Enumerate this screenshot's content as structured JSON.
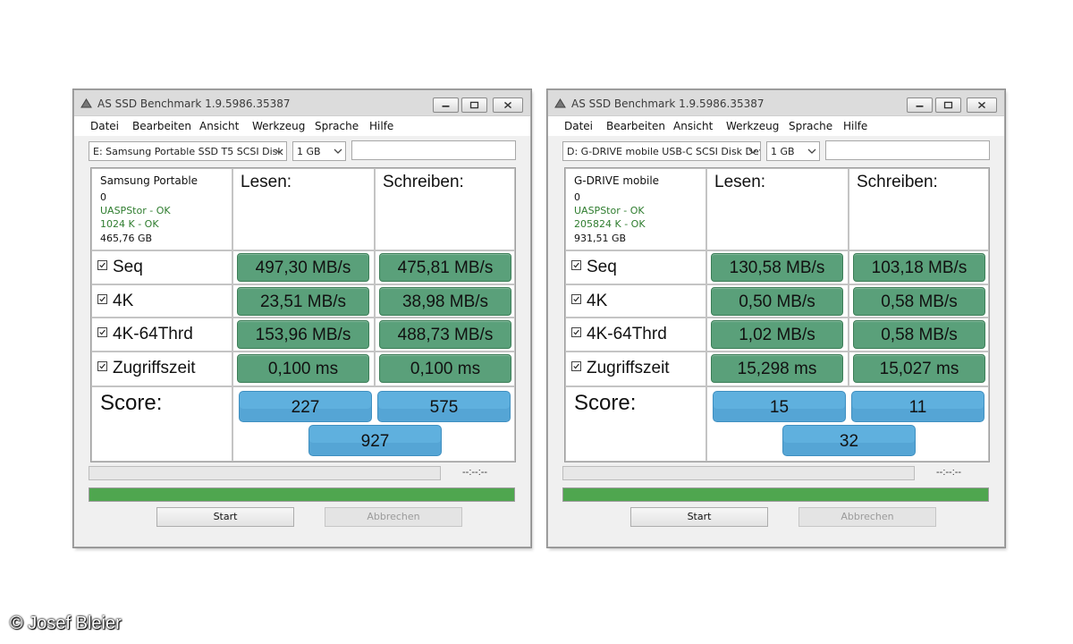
{
  "credit": "© Josef Bleier",
  "windows": [
    {
      "title": "AS SSD Benchmark 1.9.5986.35387",
      "menu": [
        "Datei",
        "Bearbeiten",
        "Ansicht",
        "Werkzeug",
        "Sprache",
        "Hilfe"
      ],
      "drive": "E: Samsung Portable SSD T5 SCSI Disk D",
      "size": "1 GB",
      "info": {
        "name": "Samsung Portable",
        "line1": "0",
        "line2": "UASPStor - OK",
        "line3": "1024 K - OK",
        "line4": "465,76 GB"
      },
      "read_label": "Lesen:",
      "write_label": "Schreiben:",
      "rows": [
        {
          "label": "Seq",
          "read": "497,30 MB/s",
          "write": "475,81 MB/s"
        },
        {
          "label": "4K",
          "read": "23,51 MB/s",
          "write": "38,98 MB/s"
        },
        {
          "label": "4K-64Thrd",
          "read": "153,96 MB/s",
          "write": "488,73 MB/s"
        },
        {
          "label": "Zugriffszeit",
          "read": "0,100 ms",
          "write": "0,100 ms"
        }
      ],
      "score_label": "Score:",
      "score_read": "227",
      "score_write": "575",
      "score_total": "927",
      "time": "--:--:--",
      "progress": 1.0,
      "start": "Start",
      "abort": "Abbrechen"
    },
    {
      "title": "AS SSD Benchmark 1.9.5986.35387",
      "menu": [
        "Datei",
        "Bearbeiten",
        "Ansicht",
        "Werkzeug",
        "Sprache",
        "Hilfe"
      ],
      "drive": "D: G-DRIVE mobile USB-C SCSI Disk Dev",
      "size": "1 GB",
      "info": {
        "name": "G-DRIVE mobile",
        "line1": "0",
        "line2": "UASPStor - OK",
        "line3": "205824 K - OK",
        "line4": "931,51 GB"
      },
      "read_label": "Lesen:",
      "write_label": "Schreiben:",
      "rows": [
        {
          "label": "Seq",
          "read": "130,58 MB/s",
          "write": "103,18 MB/s"
        },
        {
          "label": "4K",
          "read": "0,50 MB/s",
          "write": "0,58 MB/s"
        },
        {
          "label": "4K-64Thrd",
          "read": "1,02 MB/s",
          "write": "0,58 MB/s"
        },
        {
          "label": "Zugriffszeit",
          "read": "15,298 ms",
          "write": "15,027 ms"
        }
      ],
      "score_label": "Score:",
      "score_read": "15",
      "score_write": "11",
      "score_total": "32",
      "time": "--:--:--",
      "progress": 1.0,
      "start": "Start",
      "abort": "Abbrechen"
    }
  ]
}
